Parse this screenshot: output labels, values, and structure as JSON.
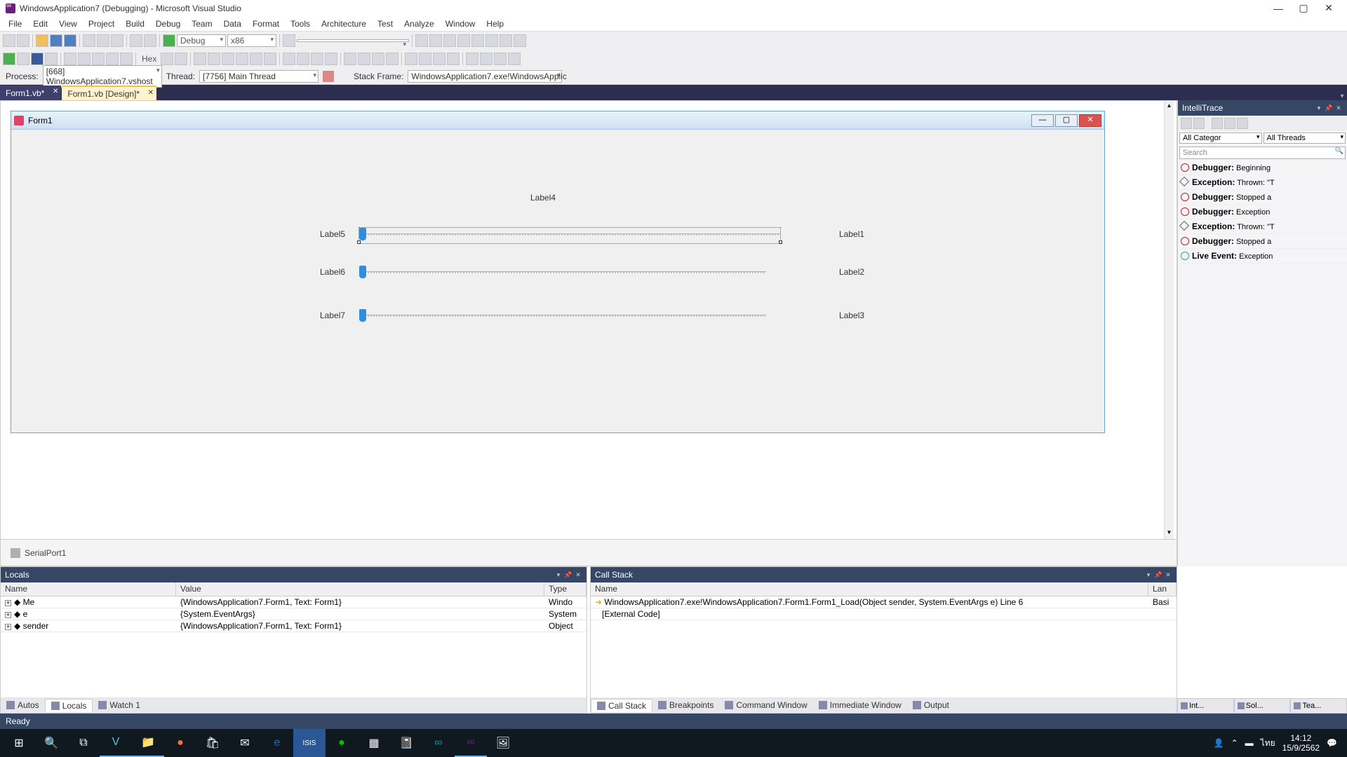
{
  "title": "WindowsApplication7 (Debugging) - Microsoft Visual Studio",
  "menu": [
    "File",
    "Edit",
    "View",
    "Project",
    "Build",
    "Debug",
    "Team",
    "Data",
    "Format",
    "Tools",
    "Architecture",
    "Test",
    "Analyze",
    "Window",
    "Help"
  ],
  "toolbar": {
    "config": "Debug",
    "platform": "x86",
    "hex": "Hex"
  },
  "debugbar": {
    "process_label": "Process:",
    "process": "[668] WindowsApplication7.vshost",
    "thread_label": "Thread:",
    "thread": "[7756] Main Thread",
    "frame_label": "Stack Frame:",
    "frame": "WindowsApplication7.exe!WindowsApplic"
  },
  "tabs": [
    {
      "label": "Form1.vb*",
      "active": false
    },
    {
      "label": "Form1.vb [Design]*",
      "active": true
    }
  ],
  "form": {
    "title": "Form1",
    "labels": {
      "l1": "Label1",
      "l2": "Label2",
      "l3": "Label3",
      "l4": "Label4",
      "l5": "Label5",
      "l6": "Label6",
      "l7": "Label7"
    },
    "component": "SerialPort1"
  },
  "intelli": {
    "title": "IntelliTrace",
    "filter1": "All Categor",
    "filter2": "All Threads",
    "search": "Search",
    "events": [
      {
        "t": "dbg",
        "b": "Debugger:",
        "r": " Beginning"
      },
      {
        "t": "exc",
        "b": "Exception:",
        "r": " Thrown: \"T"
      },
      {
        "t": "dbg",
        "b": "Debugger:",
        "r": " Stopped a"
      },
      {
        "t": "dbg",
        "b": "Debugger:",
        "r": " Exception"
      },
      {
        "t": "exc",
        "b": "Exception:",
        "r": " Thrown: \"T"
      },
      {
        "t": "dbg",
        "b": "Debugger:",
        "r": " Stopped a"
      },
      {
        "t": "live",
        "b": "Live Event:",
        "r": " Exception"
      }
    ]
  },
  "locals": {
    "title": "Locals",
    "cols": [
      "Name",
      "Value",
      "Type"
    ],
    "rows": [
      {
        "n": "Me",
        "v": "{WindowsApplication7.Form1, Text: Form1}",
        "t": "Windo"
      },
      {
        "n": "e",
        "v": "{System.EventArgs}",
        "t": "System"
      },
      {
        "n": "sender",
        "v": "{WindowsApplication7.Form1, Text: Form1}",
        "t": "Object"
      }
    ]
  },
  "callstack": {
    "title": "Call Stack",
    "cols": [
      "Name",
      "Lan"
    ],
    "rows": [
      {
        "n": "WindowsApplication7.exe!WindowsApplication7.Form1.Form1_Load(Object sender, System.EventArgs e) Line 6",
        "l": "Basi",
        "cur": true
      },
      {
        "n": "[External Code]",
        "l": "",
        "cur": false
      }
    ]
  },
  "bottom_tabs_left": [
    "Autos",
    "Locals",
    "Watch 1"
  ],
  "bottom_tabs_right": [
    "Call Stack",
    "Breakpoints",
    "Command Window",
    "Immediate Window",
    "Output"
  ],
  "right_tabs": [
    "Int...",
    "Sol...",
    "Tea..."
  ],
  "status": "Ready",
  "tray": {
    "lang": "ไทย",
    "time": "14:12",
    "date": "15/9/2562"
  }
}
